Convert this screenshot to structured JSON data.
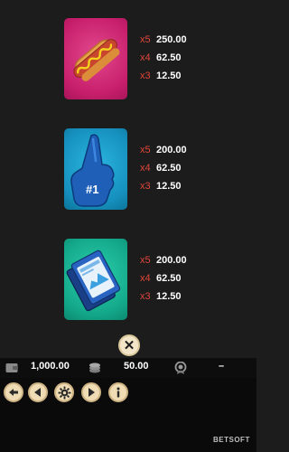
{
  "paytable": {
    "symbols": [
      {
        "name": "hotdog",
        "icon": "hotdog-icon",
        "tile_color": "#c81f6c",
        "payouts": [
          {
            "multiplier": "x5",
            "amount": "250.00"
          },
          {
            "multiplier": "x4",
            "amount": "62.50"
          },
          {
            "multiplier": "x3",
            "amount": "12.50"
          }
        ]
      },
      {
        "name": "foam-finger",
        "icon": "foam-finger-icon",
        "tile_color": "#1690be",
        "badge_text": "#1",
        "payouts": [
          {
            "multiplier": "x5",
            "amount": "200.00"
          },
          {
            "multiplier": "x4",
            "amount": "62.50"
          },
          {
            "multiplier": "x3",
            "amount": "12.50"
          }
        ]
      },
      {
        "name": "tickets",
        "icon": "tickets-icon",
        "tile_color": "#14a88a",
        "payouts": [
          {
            "multiplier": "x5",
            "amount": "200.00"
          },
          {
            "multiplier": "x4",
            "amount": "62.50"
          },
          {
            "multiplier": "x3",
            "amount": "12.50"
          }
        ]
      }
    ]
  },
  "close": {
    "icon": "close-icon",
    "label": "✕"
  },
  "info_bar": {
    "balance": "1,000.00",
    "bet": "50.00",
    "win": "–",
    "balance_icon": "wallet-icon",
    "bet_icon": "coins-icon",
    "win_icon": "medal-icon"
  },
  "controls": [
    {
      "name": "back",
      "icon": "back-arrow-icon"
    },
    {
      "name": "previous",
      "icon": "previous-icon"
    },
    {
      "name": "settings",
      "icon": "gear-icon"
    },
    {
      "name": "next",
      "icon": "next-icon"
    },
    {
      "name": "info",
      "icon": "info-icon"
    }
  ],
  "brand": {
    "logo_text": "BETSOFT"
  },
  "colors": {
    "multiplier": "#e0453a",
    "background": "#1c1c1c",
    "button_face": "#efdcb4"
  }
}
